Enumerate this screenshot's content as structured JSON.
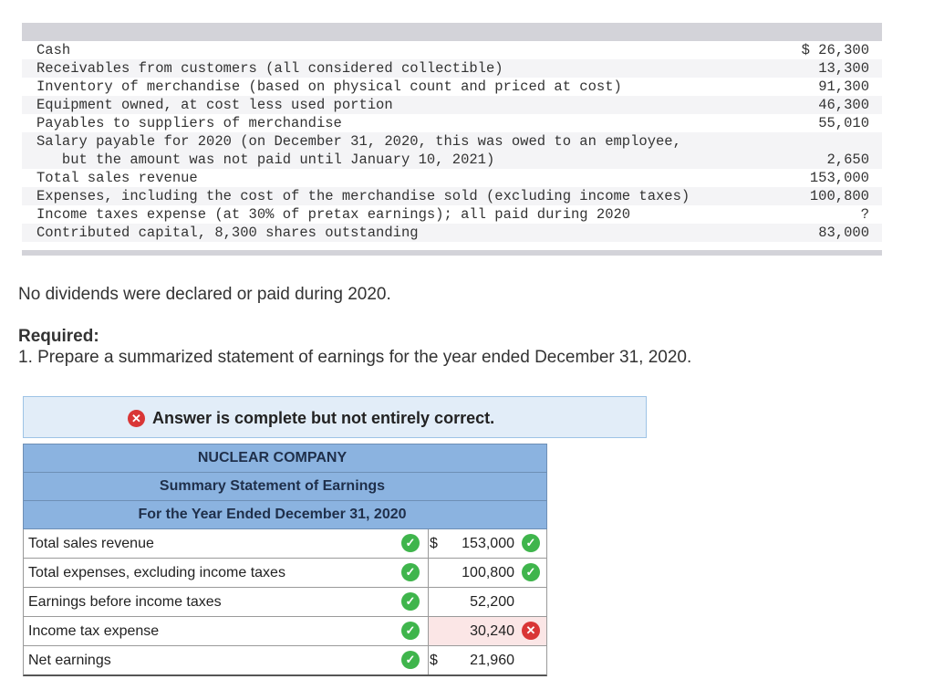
{
  "data_items": [
    {
      "label": "Cash",
      "value": "$ 26,300"
    },
    {
      "label": "Receivables from customers (all considered collectible)",
      "value": "13,300"
    },
    {
      "label": "Inventory of merchandise (based on physical count and priced at cost)",
      "value": "91,300"
    },
    {
      "label": "Equipment owned, at cost less used portion",
      "value": "46,300"
    },
    {
      "label": "Payables to suppliers of merchandise",
      "value": "55,010"
    },
    {
      "label": "Salary payable for 2020 (on December 31, 2020, this was owed to an employee,",
      "label2": "   but the amount was not paid until January 10, 2021)",
      "value": "2,650"
    },
    {
      "label": "Total sales revenue",
      "value": "153,000"
    },
    {
      "label": "Expenses, including the cost of the merchandise sold (excluding income taxes)",
      "value": "100,800"
    },
    {
      "label": "Income taxes expense (at 30% of pretax earnings); all paid during 2020",
      "value": "?"
    },
    {
      "label": "Contributed capital, 8,300 shares outstanding",
      "value": "83,000"
    }
  ],
  "note": "No dividends were declared or paid during 2020.",
  "required": {
    "title": "Required:",
    "text": "1. Prepare a summarized statement of earnings for the year ended December 31, 2020."
  },
  "banner": {
    "message": "Answer is complete but not entirely correct.",
    "status_color": "#d93636"
  },
  "statement": {
    "company": "NUCLEAR COMPANY",
    "title": "Summary Statement of Earnings",
    "period": "For the Year Ended December 31, 2020",
    "rows": [
      {
        "label": "Total sales revenue",
        "dollar": "$",
        "amount": "153,000",
        "label_status": "correct",
        "amount_status": "correct"
      },
      {
        "label": "Total expenses, excluding income taxes",
        "dollar": "",
        "amount": "100,800",
        "label_status": "correct",
        "amount_status": "correct"
      },
      {
        "label": "Earnings before income taxes",
        "dollar": "",
        "amount": "52,200",
        "label_status": "correct",
        "amount_status": ""
      },
      {
        "label": "Income tax expense",
        "dollar": "",
        "amount": "30,240",
        "label_status": "correct",
        "amount_status": "incorrect"
      },
      {
        "label": "Net earnings",
        "dollar": "$",
        "amount": "21,960",
        "label_status": "correct",
        "amount_status": ""
      }
    ]
  },
  "colors": {
    "correct": "#3fb54c",
    "incorrect": "#d93636",
    "header_fill": "#8bb3e0",
    "banner_fill": "#e2edf8"
  },
  "icons": {
    "correct": "check-circle-icon",
    "incorrect": "x-circle-icon"
  }
}
